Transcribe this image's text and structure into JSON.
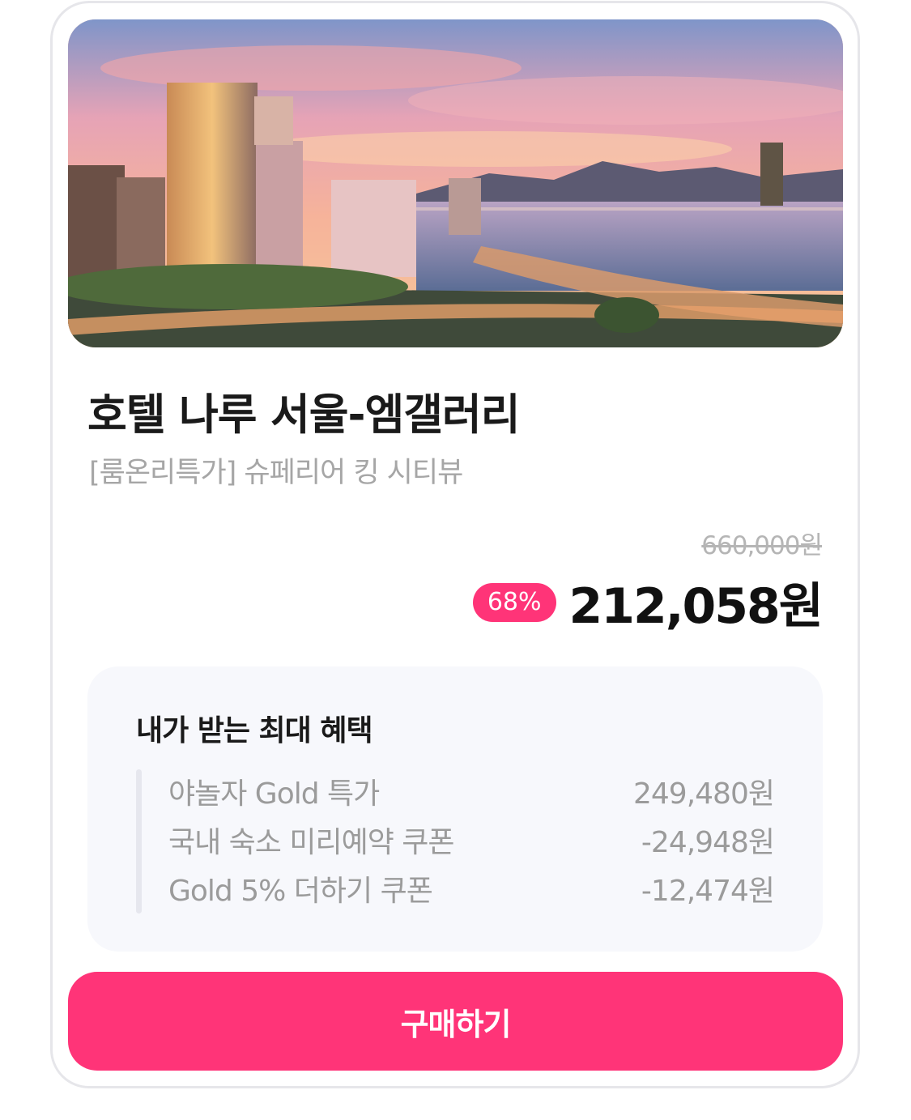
{
  "product": {
    "name": "호텔 나루 서울-엠갤러리",
    "room": "[룸온리특가] 슈페리어 킹 시티뷰",
    "original_price": "660,000원",
    "discount_rate": "68%",
    "final_price": "212,058원"
  },
  "benefits": {
    "title": "내가 받는 최대 혜택",
    "items": [
      {
        "label": "야놀자 Gold 특가",
        "amount": "249,480원"
      },
      {
        "label": "국내 숙소 미리예약 쿠폰",
        "amount": "-24,948원"
      },
      {
        "label": "Gold 5% 더하기 쿠폰",
        "amount": "-12,474원"
      }
    ]
  },
  "cta": {
    "label": "구매하기"
  },
  "colors": {
    "accent": "#ff3478",
    "benefits_bg": "#f7f8fc",
    "muted_text": "#9b9b9b"
  }
}
